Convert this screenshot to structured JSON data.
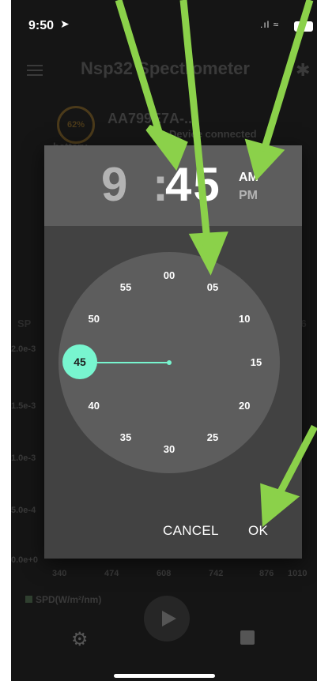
{
  "status_bar": {
    "time": "9:50"
  },
  "app": {
    "title": "Nsp32 Spectrometer"
  },
  "device": {
    "battery_percent": "62%",
    "battery_label": "battery",
    "id": "AA799E7A-...",
    "status": "Device connected"
  },
  "background": {
    "spd_tab_label": "SP",
    "wavelength_tab_label": "876",
    "y_ticks": [
      "2.0e-3",
      "1.5e-3",
      "1.0e-3",
      "5.0e-4",
      "0.0e+0"
    ],
    "x_ticks": [
      "340",
      "474",
      "608",
      "742",
      "876",
      "1010"
    ],
    "legend_label": "SPD(W/m²/nm)"
  },
  "time_picker": {
    "hour": "9",
    "minute": "45",
    "am_label": "AM",
    "pm_label": "PM",
    "selected_minute": "45",
    "minute_labels": [
      "00",
      "05",
      "10",
      "15",
      "20",
      "25",
      "30",
      "35",
      "40",
      "45",
      "50",
      "55"
    ],
    "cancel_label": "CANCEL",
    "ok_label": "OK"
  },
  "colors": {
    "accent": "#78f5cf",
    "annotation_arrow": "#8bd14a",
    "dialog_bg": "#424242",
    "header_bg": "#5d5d5d"
  }
}
